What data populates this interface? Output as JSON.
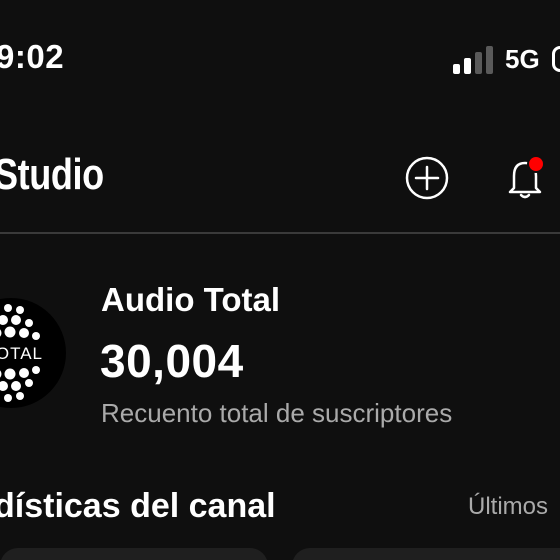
{
  "status_bar": {
    "time": "9:02",
    "network": "5G",
    "icons": [
      "signal-icon",
      "battery-icon"
    ]
  },
  "header": {
    "title": "Studio",
    "icons": [
      "create-icon",
      "notifications-icon"
    ],
    "notification_dot_color": "#ff0000"
  },
  "channel": {
    "name": "Audio Total",
    "subscriber_count": "30,004",
    "subscriber_label": "Recuento total de suscriptores",
    "avatar_text": "TOTAL"
  },
  "stats": {
    "title": "dísticas del canal",
    "period_label": "Últimos"
  },
  "colors": {
    "background": "#0f0f0f",
    "text": "#ffffff",
    "secondary_text": "#aaaaaa",
    "card": "#1f1f1f"
  }
}
